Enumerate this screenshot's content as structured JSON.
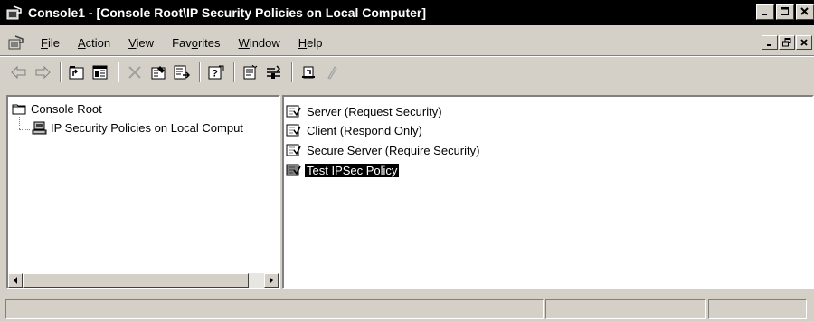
{
  "window": {
    "title": "Console1 - [Console Root\\IP Security Policies on Local Computer]",
    "controls": [
      "minimize",
      "maximize",
      "close"
    ]
  },
  "menubar": {
    "items": [
      {
        "label": "File",
        "accel": "F",
        "rest": "ile"
      },
      {
        "label": "Action",
        "accel": "A",
        "rest": "ction"
      },
      {
        "label": "View",
        "accel": "V",
        "rest": "iew"
      },
      {
        "label": "Favorites",
        "pre": "Fav",
        "accel": "o",
        "rest": "rites"
      },
      {
        "label": "Window",
        "accel": "W",
        "rest": "indow"
      },
      {
        "label": "Help",
        "accel": "H",
        "rest": "elp"
      }
    ]
  },
  "toolbar": {
    "buttons": [
      "back-icon",
      "forward-icon",
      "up-one-level-icon",
      "show-hide-console-tree-icon",
      "delete-icon",
      "properties-icon",
      "export-list-icon",
      "help-icon",
      "create-policy-icon",
      "manage-filter-lists-icon",
      "assign-icon",
      "unassign-icon"
    ]
  },
  "tree": {
    "root": "Console Root",
    "child": "IP Security Policies on Local Comput"
  },
  "list": {
    "items": [
      {
        "label": "Server (Request Security)",
        "selected": false
      },
      {
        "label": "Client (Respond Only)",
        "selected": false
      },
      {
        "label": "Secure Server (Require Security)",
        "selected": false
      },
      {
        "label": "Test IPSec Policy",
        "selected": true
      }
    ]
  },
  "statusbar": {
    "cells": [
      "",
      "",
      ""
    ]
  }
}
